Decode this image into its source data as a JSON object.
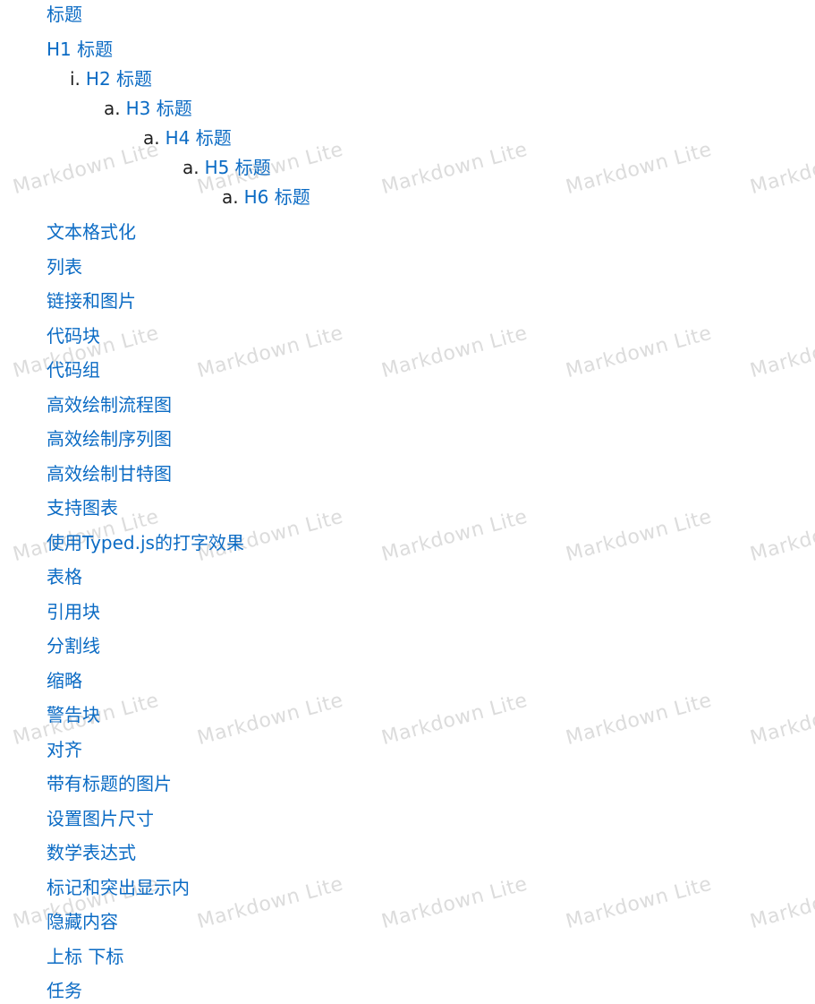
{
  "watermark_text": "Markdown Lite",
  "link_color": "#0b6bc4",
  "toc": {
    "title": "标题",
    "headings": [
      {
        "marker": "",
        "label": "H1 标题"
      },
      {
        "marker": "i.",
        "label": "H2 标题"
      },
      {
        "marker": "a.",
        "label": "H3 标题"
      },
      {
        "marker": "a.",
        "label": "H4 标题"
      },
      {
        "marker": "a.",
        "label": "H5 标题"
      },
      {
        "marker": "a.",
        "label": "H6 标题"
      }
    ],
    "items": [
      "文本格式化",
      "列表",
      "链接和图片",
      "代码块",
      "代码组",
      "高效绘制流程图",
      "高效绘制序列图",
      "高效绘制甘特图",
      "支持图表",
      "使用Typed.js的打字效果",
      "表格",
      "引用块",
      "分割线",
      "缩略",
      "警告块",
      "对齐",
      "带有标题的图片",
      "设置图片尺寸",
      "数学表达式",
      "标记和突出显示内",
      "隐藏内容",
      "上标 下标",
      "任务"
    ]
  }
}
